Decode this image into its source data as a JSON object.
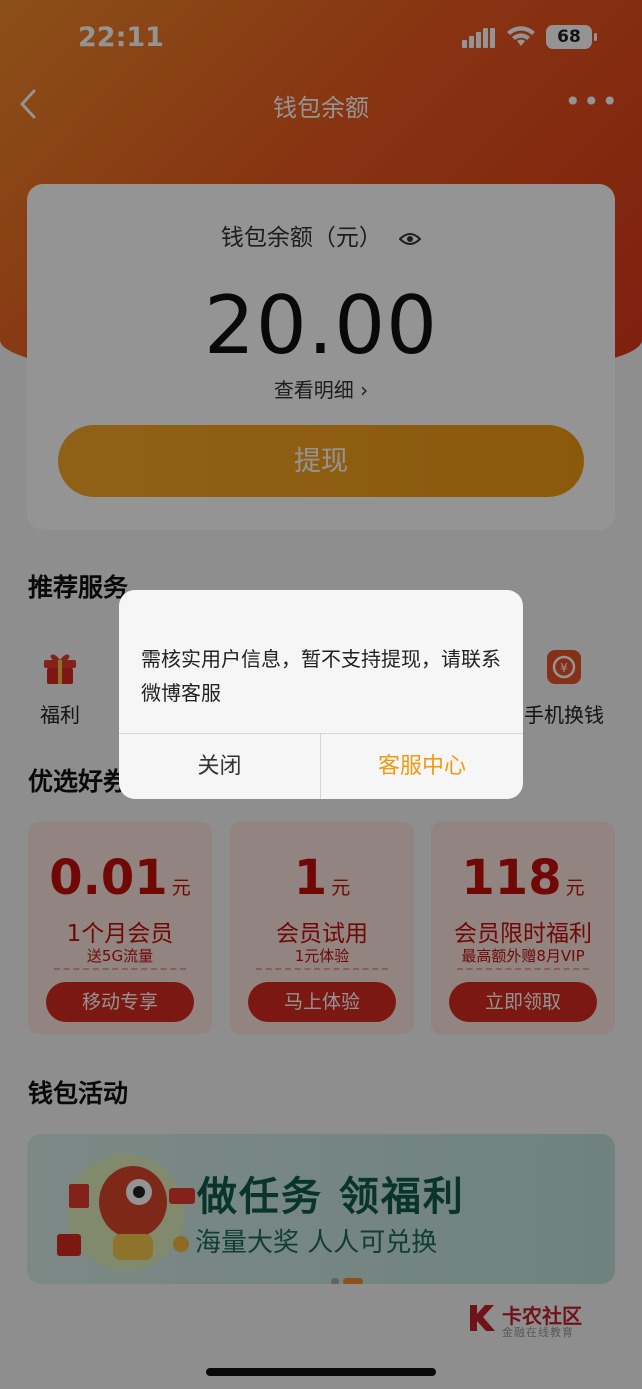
{
  "status_bar": {
    "time": "22:11",
    "battery": "68"
  },
  "nav": {
    "title": "钱包余额"
  },
  "balance_card": {
    "label": "钱包余额（元）",
    "amount": "20.00",
    "detail_link": "查看明细 ›",
    "withdraw_button": "提现"
  },
  "services": {
    "title": "推荐服务",
    "items": [
      {
        "label": "福利",
        "icon": "gift-icon"
      },
      {
        "label": "手机换钱",
        "icon": "phone-exchange-icon"
      }
    ]
  },
  "coupons": {
    "title": "优选好券",
    "items": [
      {
        "price": "0.01",
        "unit": "元",
        "title": "1个月会员",
        "sub": "送5G流量",
        "button": "移动专享"
      },
      {
        "price": "1",
        "unit": "元",
        "title": "会员试用",
        "sub": "1元体验",
        "button": "马上体验"
      },
      {
        "price": "118",
        "unit": "元",
        "title": "会员限时福利",
        "sub": "最高额外赠8月VIP",
        "button": "立即领取"
      }
    ]
  },
  "activity": {
    "title": "钱包活动",
    "banner_title": "做任务 领福利",
    "banner_sub": "海量大奖 人人可兑换"
  },
  "watermark": {
    "title": "卡农社区",
    "sub": "金融在线教育"
  },
  "dialog": {
    "message": "需核实用户信息，暂不支持提现，请联系微博客服",
    "close_button": "关闭",
    "service_button": "客服中心"
  },
  "colors": {
    "accent": "#f09a14",
    "brand_red": "#c2110c",
    "overlay": "rgba(0,0,0,0.42)"
  }
}
